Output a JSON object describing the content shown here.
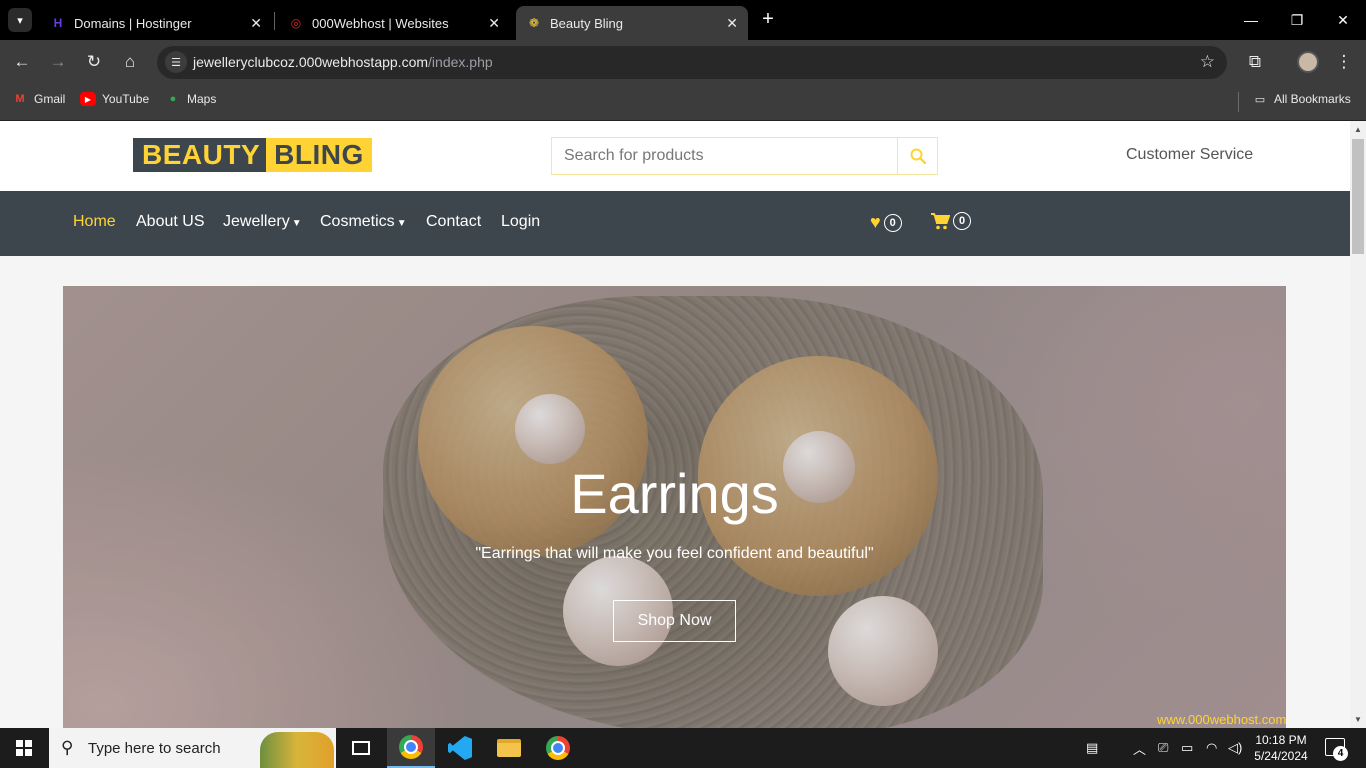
{
  "browser": {
    "tabs": [
      {
        "title": "Domains | Hostinger",
        "favicon": "hostinger-icon",
        "favicon_color": "#673de6"
      },
      {
        "title": "000Webhost | Websites",
        "favicon": "000webhost-icon",
        "favicon_color": "#d62a2a"
      },
      {
        "title": "Beauty Bling",
        "favicon": "beauty-bling-icon",
        "favicon_color": "#ffd333"
      }
    ],
    "active_tab": 2,
    "url_host": "jewelleryclubcoz.000webhostapp.com",
    "url_path": "/index.php",
    "bookmarks": [
      {
        "label": "Gmail",
        "icon": "gmail-icon"
      },
      {
        "label": "YouTube",
        "icon": "youtube-icon"
      },
      {
        "label": "Maps",
        "icon": "maps-icon"
      }
    ],
    "all_bookmarks_label": "All Bookmarks"
  },
  "site": {
    "logo_part1": "BEAUTY",
    "logo_part2": "BLING",
    "search_placeholder": "Search for products",
    "customer_service": "Customer Service",
    "nav": {
      "home": "Home",
      "about": "About US",
      "jewellery": "Jewellery",
      "cosmetics": "Cosmetics",
      "contact": "Contact",
      "login": "Login"
    },
    "wishlist_count": "0",
    "cart_count": "0",
    "hero": {
      "title": "Earrings",
      "subtitle": "\"Earrings that will make you feel confident and beautiful\"",
      "button": "Shop Now"
    },
    "host_badge": "www.000webhost.com",
    "colors": {
      "accent": "#ffd333",
      "dark": "#3d464d"
    }
  },
  "taskbar": {
    "search_placeholder": "Type here to search",
    "time": "10:18 PM",
    "date": "5/24/2024",
    "notification_count": "4"
  }
}
